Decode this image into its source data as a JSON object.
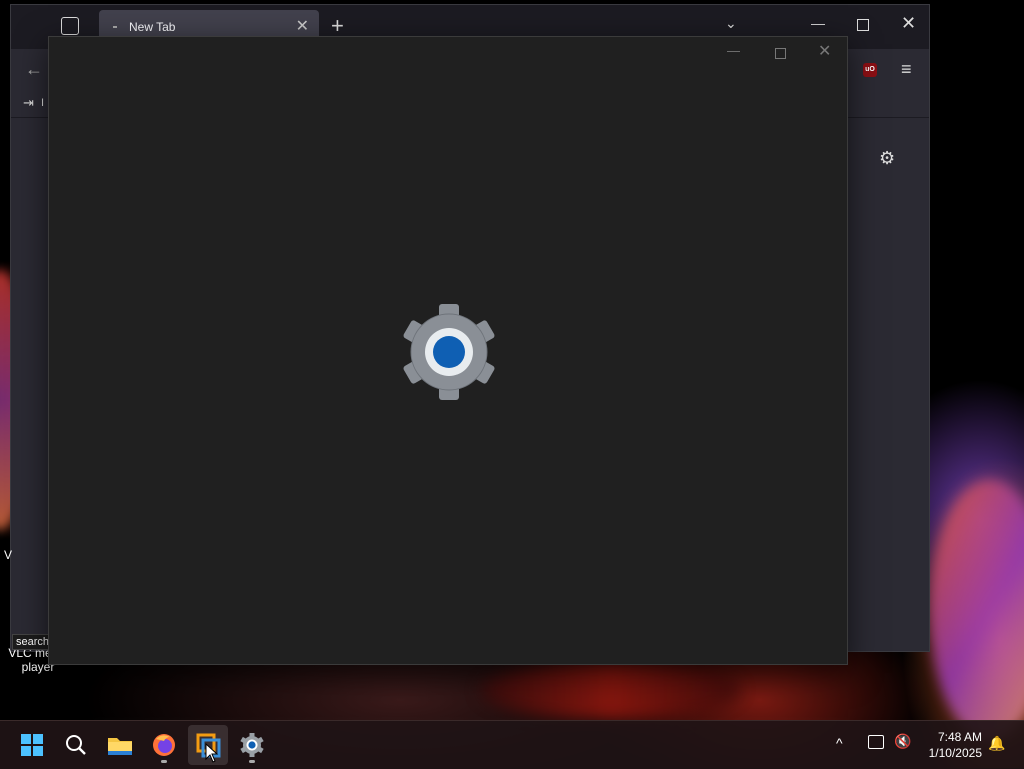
{
  "browser": {
    "tab": {
      "title": "New Tab",
      "close": "✕"
    },
    "new_tab": "+",
    "tab_list": "⌄",
    "window": {
      "minimize": "—",
      "close": "✕"
    },
    "back": "←",
    "ublock_badge": "uO",
    "menu": "≡",
    "bookmark_label": "I",
    "settings_gear": "⚙"
  },
  "desktop": {
    "vlc_label": "VLC media player",
    "w_label": "V",
    "search_tooltip": "search"
  },
  "settings_window": {
    "minimize": "—",
    "close": "✕",
    "splash_icon": "settings-gear-icon"
  },
  "taskbar": {
    "items": [
      {
        "name": "start-button",
        "icon": "windows-logo-icon"
      },
      {
        "name": "search-button",
        "icon": "search-icon"
      },
      {
        "name": "file-explorer",
        "icon": "folder-icon"
      },
      {
        "name": "firefox",
        "icon": "firefox-icon"
      },
      {
        "name": "vmware",
        "icon": "vmware-icon"
      },
      {
        "name": "settings",
        "icon": "gear-icon"
      }
    ],
    "tray": {
      "chevron": "^",
      "volume": "🔇",
      "bell": "🔔"
    },
    "clock": {
      "time": "7:48 AM",
      "date": "1/10/2025"
    }
  }
}
